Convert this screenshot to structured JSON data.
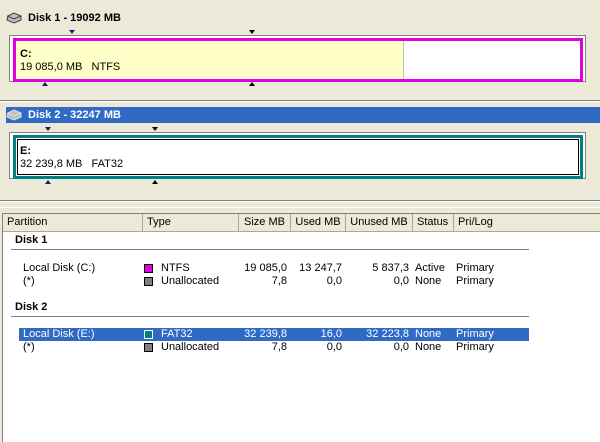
{
  "disks": [
    {
      "title": "Disk 1 - 19092 MB",
      "selected": false,
      "partition": {
        "letter": "C:",
        "size": "19 085,0 MB",
        "fs": "NTFS",
        "frame_color": "#e000e0",
        "fill_color": "#ffffc8"
      }
    },
    {
      "title": "Disk 2 - 32247 MB",
      "selected": true,
      "partition": {
        "letter": "E:",
        "size": "32 239,8 MB",
        "fs": "FAT32",
        "frame_color": "#008080",
        "fill_color": "#ffffff"
      }
    }
  ],
  "list": {
    "columns": [
      "Partition",
      "Type",
      "Size MB",
      "Used MB",
      "Unused MB",
      "Status",
      "Pri/Log"
    ],
    "groups": [
      {
        "title": "Disk 1",
        "rows": [
          {
            "partition": "Local Disk (C:)",
            "type": "NTFS",
            "swatch": "#e000e0",
            "size": "19 085,0",
            "used": "13 247,7",
            "unused": "5 837,3",
            "status": "Active",
            "prilog": "Primary",
            "selected": false
          },
          {
            "partition": "(*)",
            "type": "Unallocated",
            "swatch": "#808080",
            "size": "7,8",
            "used": "0,0",
            "unused": "0,0",
            "status": "None",
            "prilog": "Primary",
            "selected": false
          }
        ]
      },
      {
        "title": "Disk 2",
        "rows": [
          {
            "partition": "Local Disk (E:)",
            "type": "FAT32",
            "swatch": "#008080",
            "size": "32 239,8",
            "used": "16,0",
            "unused": "32 223,8",
            "status": "None",
            "prilog": "Primary",
            "selected": true
          },
          {
            "partition": "(*)",
            "type": "Unallocated",
            "swatch": "#808080",
            "size": "7,8",
            "used": "0,0",
            "unused": "0,0",
            "status": "None",
            "prilog": "Primary",
            "selected": false
          }
        ]
      }
    ]
  }
}
